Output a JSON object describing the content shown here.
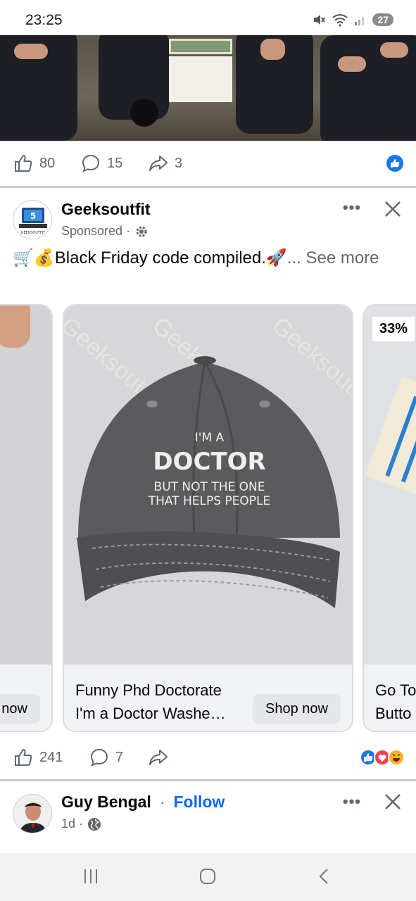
{
  "status_bar": {
    "time": "23:25",
    "battery": "27"
  },
  "prev_post": {
    "likes": "80",
    "comments": "15",
    "shares": "3"
  },
  "ad_post": {
    "author": "Geeksoutfit",
    "sponsored_label": "Sponsored ·",
    "avatar_text": "GEEKSOUTFIT",
    "caption_emoji": "🛒💰",
    "caption_text": "Black Friday code compiled.",
    "caption_emoji_end": "🚀",
    "see_more": "... See more",
    "cards": [
      {
        "shop_label": "now"
      },
      {
        "title": "Funny Phd Doctorate I'm a Doctor Washe…",
        "shop_label": "Shop now",
        "watermark": "Geeksoutfit",
        "cap_lines": [
          "I'M A",
          "DOCTOR",
          "BUT NOT THE ONE",
          "THAT HELPS PEOPLE"
        ]
      },
      {
        "discount": "33%",
        "title": "Go To Butto"
      }
    ],
    "likes": "241",
    "comments": "7"
  },
  "next_post": {
    "author": "Guy Bengal",
    "separator": "·",
    "follow": "Follow",
    "time": "1d ·"
  },
  "colors": {
    "facebook_blue": "#0866ff",
    "muted_text": "#65676b",
    "card_footer": "#f0f2f5"
  }
}
